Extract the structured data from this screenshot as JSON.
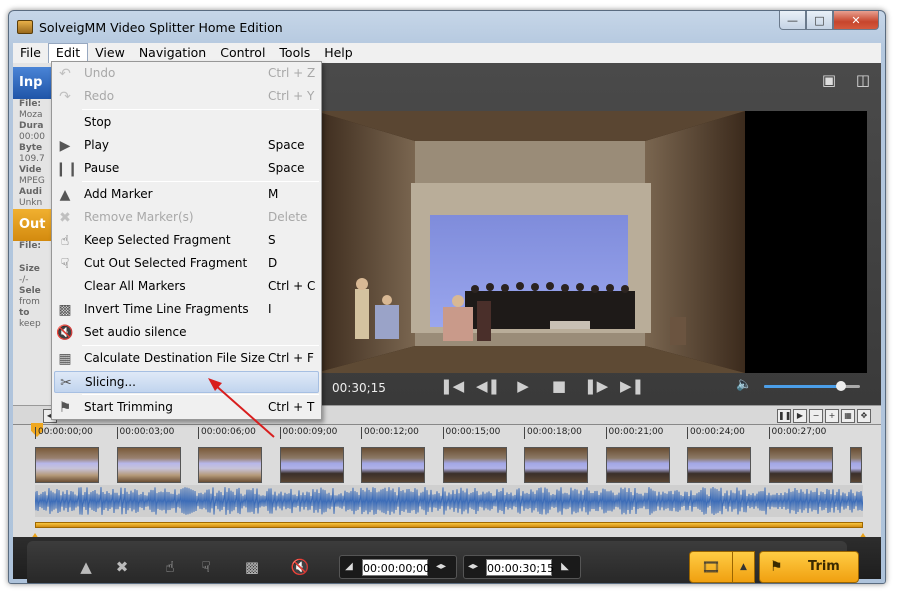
{
  "window": {
    "title": "SolveigMM Video Splitter Home Edition",
    "controls": {
      "minimize": "—",
      "maximize": "□",
      "close": "✕"
    }
  },
  "menubar": [
    "File",
    "Edit",
    "View",
    "Navigation",
    "Control",
    "Tools",
    "Help"
  ],
  "edit_menu": [
    {
      "label": "Undo",
      "shortcut": "Ctrl + Z",
      "disabled": true,
      "icon": "undo-icon"
    },
    {
      "label": "Redo",
      "shortcut": "Ctrl + Y",
      "disabled": true,
      "icon": "redo-icon"
    },
    {
      "label": "Stop",
      "shortcut": "",
      "disabled": false,
      "icon": ""
    },
    {
      "label": "Play",
      "shortcut": "Space",
      "disabled": false,
      "icon": "play-icon"
    },
    {
      "label": "Pause",
      "shortcut": "Space",
      "disabled": false,
      "icon": "pause-icon"
    },
    {
      "label": "Add Marker",
      "shortcut": "M",
      "disabled": false,
      "icon": "marker-icon"
    },
    {
      "label": "Remove Marker(s)",
      "shortcut": "Delete",
      "disabled": true,
      "icon": "remove-marker-icon"
    },
    {
      "label": "Keep Selected Fragment",
      "shortcut": "S",
      "disabled": false,
      "icon": "thumbs-up-icon"
    },
    {
      "label": "Cut Out Selected Fragment",
      "shortcut": "D",
      "disabled": false,
      "icon": "thumbs-down-icon"
    },
    {
      "label": "Clear All Markers",
      "shortcut": "Ctrl + C",
      "disabled": false,
      "icon": ""
    },
    {
      "label": "Invert Time Line Fragments",
      "shortcut": "I",
      "disabled": false,
      "icon": "invert-icon"
    },
    {
      "label": "Set audio silence",
      "shortcut": "",
      "disabled": false,
      "icon": "mute-icon"
    },
    {
      "label": "Calculate Destination File Size",
      "shortcut": "Ctrl + F",
      "disabled": false,
      "icon": "calculate-icon"
    },
    {
      "label": "Slicing...",
      "shortcut": "",
      "disabled": false,
      "icon": "slicing-icon",
      "highlighted": true
    },
    {
      "label": "Start Trimming",
      "shortcut": "Ctrl + T",
      "disabled": false,
      "icon": "flag-icon"
    }
  ],
  "left_panel": {
    "input_label": "Inp",
    "input_lines": [
      "File:",
      "Moza",
      "Dura",
      "00:00",
      "Byte",
      "109.7",
      "Vide",
      "MPEG",
      "Audi",
      "Unkn"
    ],
    "output_label": "Out",
    "output_lines": [
      "File:",
      "",
      "Size",
      "-/-",
      "Sele",
      "from",
      "to",
      "keep"
    ]
  },
  "player": {
    "current_time": "00:30;15",
    "volume_level": 0.8
  },
  "timeline": {
    "ticks": [
      "00:00:00;00",
      "00:00:03;00",
      "00:00:06;00",
      "00:00:09;00",
      "00:00:12;00",
      "00:00:15;00",
      "00:00:18;00",
      "00:00:21;00",
      "00:00:24;00",
      "00:00:27;00"
    ]
  },
  "bottom": {
    "start_time": "00:00:00;00",
    "end_time": "00:00:30;15",
    "trim_label": "Trim"
  },
  "colors": {
    "accent_orange": "#f0a820",
    "input_blue": "#1f55a8",
    "highlight": "#c1d4ee",
    "arrow_red": "#d81e1e"
  }
}
